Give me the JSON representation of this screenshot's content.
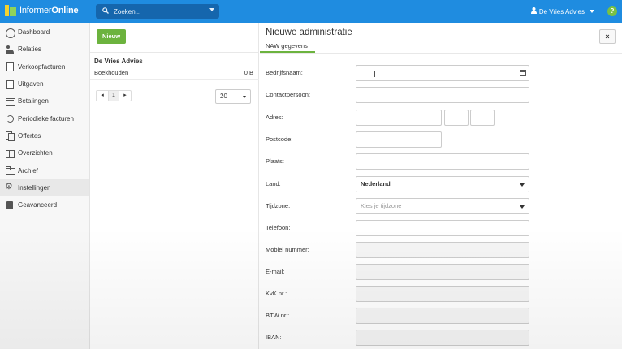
{
  "app": {
    "logo_prefix": "Informer",
    "logo_suffix": "Online"
  },
  "search": {
    "placeholder": "Zoeken..."
  },
  "user": {
    "name": "De Vries Advies"
  },
  "help": {
    "label": "?"
  },
  "sidebar": {
    "items": [
      {
        "label": "Dashboard"
      },
      {
        "label": "Relaties"
      },
      {
        "label": "Verkoopfacturen"
      },
      {
        "label": "Uitgaven"
      },
      {
        "label": "Betalingen"
      },
      {
        "label": "Periodieke facturen"
      },
      {
        "label": "Offertes"
      },
      {
        "label": "Overzichten"
      },
      {
        "label": "Archief"
      },
      {
        "label": "Instellingen",
        "active": true
      },
      {
        "label": "Geavanceerd"
      }
    ]
  },
  "middle": {
    "new_button": "Nieuw",
    "administration": {
      "name": "De Vries Advies",
      "type": "Boekhouden",
      "size": "0 B"
    },
    "pager": {
      "prev": "◂",
      "current": "1",
      "next": "▸"
    },
    "page_size": "20"
  },
  "panel": {
    "title": "Nieuwe administratie",
    "tab": "NAW gegevens",
    "close": "×",
    "fields": {
      "bedrijfsnaam": {
        "label": "Bedrijfsnaam:",
        "value": ""
      },
      "contactpersoon": {
        "label": "Contactpersoon:",
        "value": ""
      },
      "adres": {
        "label": "Adres:",
        "street": "",
        "number": "",
        "addition": ""
      },
      "postcode": {
        "label": "Postcode:",
        "value": ""
      },
      "plaats": {
        "label": "Plaats:",
        "value": ""
      },
      "land": {
        "label": "Land:",
        "value": "Nederland"
      },
      "tijdzone": {
        "label": "Tijdzone:",
        "placeholder": "Kies je tijdzone"
      },
      "telefoon": {
        "label": "Telefoon:",
        "value": ""
      },
      "mobiel": {
        "label": "Mobiel nummer:",
        "value": ""
      },
      "email": {
        "label": "E-mail:",
        "value": ""
      },
      "kvk": {
        "label": "KvK nr.:",
        "value": ""
      },
      "btw": {
        "label": "BTW nr.:",
        "value": ""
      },
      "iban": {
        "label": "IBAN:",
        "value": ""
      }
    }
  },
  "colors": {
    "topbar": "#1f8ce0",
    "accent_green": "#6cb33e",
    "search_bg": "#1566ad"
  }
}
